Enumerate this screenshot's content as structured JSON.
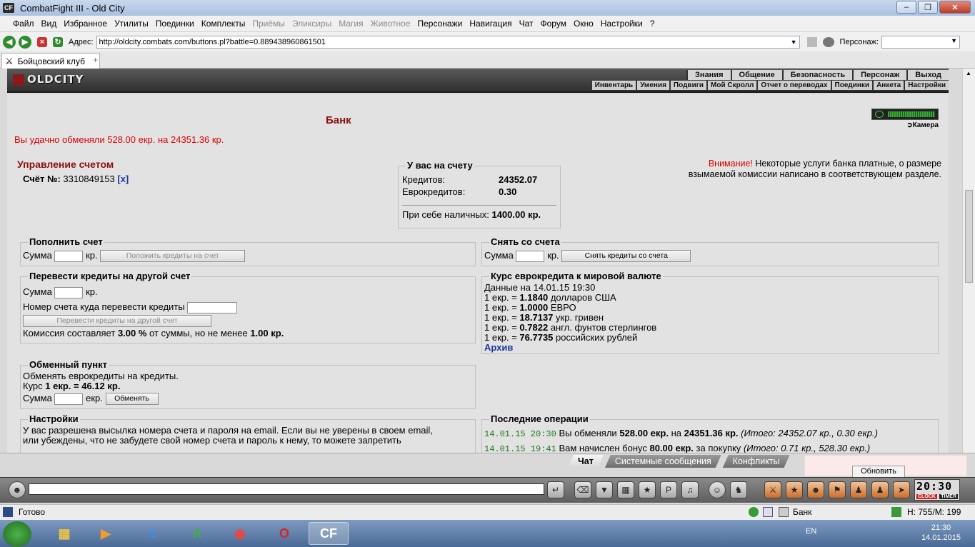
{
  "window": {
    "title": "CombatFight III - Old City",
    "app_icon": "CF"
  },
  "menu": [
    {
      "label": "Файл",
      "disabled": false
    },
    {
      "label": "Вид",
      "disabled": false
    },
    {
      "label": "Избранное",
      "disabled": false
    },
    {
      "label": "Утилиты",
      "disabled": false
    },
    {
      "label": "Поединки",
      "disabled": false
    },
    {
      "label": "Комплекты",
      "disabled": false
    },
    {
      "label": "Приёмы",
      "disabled": true
    },
    {
      "label": "Эликсиры",
      "disabled": true
    },
    {
      "label": "Магия",
      "disabled": true
    },
    {
      "label": "Животное",
      "disabled": true
    },
    {
      "label": "Персонажи",
      "disabled": false
    },
    {
      "label": "Навигация",
      "disabled": false
    },
    {
      "label": "Чат",
      "disabled": false
    },
    {
      "label": "Форум",
      "disabled": false
    },
    {
      "label": "Окно",
      "disabled": false
    },
    {
      "label": "Настройки",
      "disabled": false
    },
    {
      "label": "?",
      "disabled": false
    }
  ],
  "address": {
    "label": "Адрес:",
    "url": "http://oldcity.combats.com/buttons.pl?battle=0.889438960861501",
    "persona_label": "Персонаж:"
  },
  "tab": {
    "label": "Бойцовский клуб",
    "new_tab": "+"
  },
  "game": {
    "logo": "OLDCITY",
    "top_links": [
      "Знания",
      "Общение",
      "Безопасность",
      "Персонаж",
      "Выход"
    ],
    "sub_links": [
      "Инвентарь",
      "Умения",
      "Подвиги",
      "Мой Скролл",
      "Отчет о переводах",
      "Поединки",
      "Анкета",
      "Настройки"
    ]
  },
  "bank": {
    "title": "Банк",
    "message": "Вы удачно обменяли 528.00 екр. на 24351.36 кр.",
    "camera": "Камера",
    "manage_title": "Управление счетом",
    "account_label": "Счёт №:",
    "account_no": "3310849153",
    "account_close": "[x]",
    "warning_prefix": "Внимание!",
    "warning_text": " Некоторые услуги банка платные, о размере взымаемой комиссии написано в соответствующем разделе.",
    "balance": {
      "legend": "У вас на счету",
      "credits_label": "Кредитов:",
      "credits": "24352.07",
      "eurocredits_label": "Еврокредитов:",
      "eurocredits": "0.30",
      "cash_label": "При себе наличных:",
      "cash": "1400.00 кр."
    },
    "deposit": {
      "legend": "Пополнить счет",
      "sum_label": "Сумма",
      "unit": "кр.",
      "button": "Положить кредиты на счет"
    },
    "withdraw": {
      "legend": "Снять со счета",
      "sum_label": "Сумма",
      "unit": "кр.",
      "button": "Снять кредиты со счета"
    },
    "transfer": {
      "legend": "Перевести кредиты на другой счет",
      "sum_label": "Сумма",
      "unit": "кр.",
      "target_label": "Номер счета куда перевести кредиты",
      "button": "Перевести кредиты на другой счет",
      "fee_a": "Комиссия составляет ",
      "fee_pct": "3.00 %",
      "fee_b": " от суммы, но не менее ",
      "fee_min": "1.00 кр."
    },
    "rates": {
      "legend": "Курс еврокредита к мировой валюте",
      "date": "Данные на 14.01.15 19:30",
      "prefix": "1 екр. = ",
      "items": [
        {
          "value": "1.1840",
          "name": "долларов США"
        },
        {
          "value": "1.0000",
          "name": "ЕВРО"
        },
        {
          "value": "18.7137",
          "name": "укр. гривен"
        },
        {
          "value": "0.7822",
          "name": "англ. фунтов стерлингов"
        },
        {
          "value": "76.7735",
          "name": "российских рублей"
        }
      ],
      "archive": "Архив"
    },
    "exchange": {
      "legend": "Обменный пункт",
      "text": "Обменять еврокредиты на кредиты.",
      "rate_label": "Курс ",
      "rate": "1 екр. = 46.12 кр.",
      "sum_label": "Сумма",
      "unit": "екр.",
      "button": "Обменять"
    },
    "settings": {
      "legend": "Настройки",
      "line1": "У вас разрешена высылка номера счета и пароля на email. Если вы не уверены в своем email,",
      "line2": "или убеждены, что не забудете свой номер счета и пароль к нему, то можете запретить"
    },
    "operations": {
      "legend": "Последние операции",
      "items": [
        {
          "time": "14.01.15 20:30",
          "a": " Вы обменяли ",
          "b": "528.00 екр.",
          "c": " на ",
          "d": "24351.36 кр.",
          "e": " (Итого: 24352.07 кр., 0.30 екр.)"
        },
        {
          "time": "14.01.15 19:41",
          "a": " Вам начислен бонус ",
          "b": "80.00 екр.",
          "c": " за покупку ",
          "d": "",
          "e": "(Итого: 0.71 кр., 528.30 екр.)"
        }
      ]
    }
  },
  "chat": {
    "tabs": [
      "Чат",
      "Системные сообщения",
      "Конфликты"
    ],
    "refresh": "Обновить"
  },
  "clock": {
    "time": "20:30",
    "clock_label": "CLOCK",
    "timer_label": "TIMER"
  },
  "status": {
    "ready": "Готово",
    "zone": "Банк",
    "hp": "H: 755/M: 199"
  },
  "taskbar": {
    "lang": "EN",
    "time": "21:30",
    "date": "14.01.2015"
  }
}
